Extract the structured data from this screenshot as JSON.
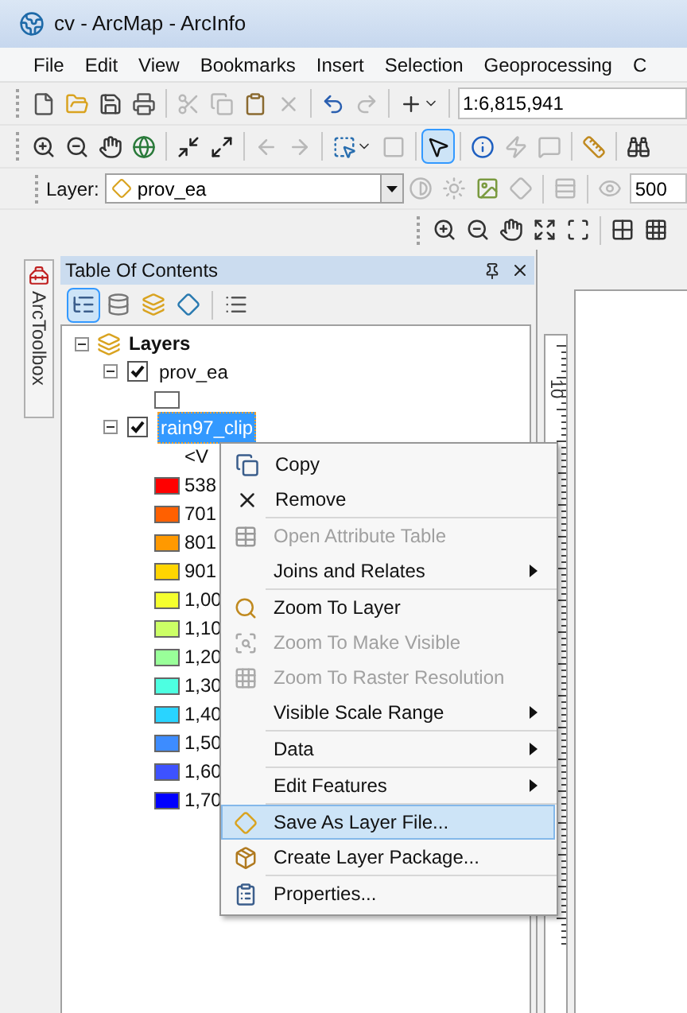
{
  "window": {
    "title": "cv - ArcMap - ArcInfo"
  },
  "menu_bar": [
    "File",
    "Edit",
    "View",
    "Bookmarks",
    "Insert",
    "Selection",
    "Geoprocessing",
    "C"
  ],
  "standard_toolbar": {
    "buttons": [
      {
        "disabled": false
      },
      {
        "disabled": false
      },
      {
        "disabled": false
      },
      {
        "disabled": false
      },
      {
        "disabled": true
      },
      {
        "disabled": true
      },
      {
        "disabled": false
      },
      {
        "disabled": true
      },
      {
        "disabled": false
      },
      {
        "disabled": true
      },
      {
        "disabled": false
      }
    ],
    "scale": "1:6,815,941"
  },
  "tools_toolbar": {
    "buttons": [
      {
        "disabled": false,
        "selected": false
      },
      {
        "disabled": false,
        "selected": false
      },
      {
        "disabled": false,
        "selected": false
      },
      {
        "disabled": false,
        "selected": false
      },
      {
        "disabled": false,
        "selected": false
      },
      {
        "disabled": false,
        "selected": false
      },
      {
        "disabled": true,
        "selected": false
      },
      {
        "disabled": true,
        "selected": false
      },
      {
        "disabled": false,
        "selected": false
      },
      {
        "disabled": true,
        "selected": false
      },
      {
        "disabled": false,
        "selected": true
      },
      {
        "disabled": false,
        "selected": false
      },
      {
        "disabled": true,
        "selected": false
      },
      {
        "disabled": true,
        "selected": false
      },
      {
        "disabled": false,
        "selected": false
      },
      {
        "disabled": false,
        "selected": false
      }
    ]
  },
  "effects_toolbar": {
    "label": "Layer:",
    "layer": "prov_ea",
    "buttons": [
      {
        "disabled": true
      },
      {
        "disabled": true
      },
      {
        "disabled": false
      },
      {
        "disabled": true
      },
      {
        "disabled": true
      },
      {
        "disabled": true
      }
    ],
    "value": "500"
  },
  "layout_toolbar": {
    "buttons": [
      {
        "disabled": false
      },
      {
        "disabled": false
      },
      {
        "disabled": false
      },
      {
        "disabled": false
      },
      {
        "disabled": false
      },
      {
        "disabled": false
      },
      {
        "disabled": false
      }
    ]
  },
  "side_tab": "ArcToolbox",
  "toc": {
    "title": "Table Of Contents",
    "views": [
      {
        "selected": true
      },
      {
        "selected": false
      },
      {
        "selected": false
      },
      {
        "selected": false
      },
      {
        "selected": false
      }
    ],
    "tree": {
      "label": "Layers",
      "expanded": true,
      "children": [
        {
          "label": "prov_ea",
          "checked": true,
          "expanded": true,
          "selected": false,
          "symbols": [
            {
              "color": "#ffffff"
            }
          ]
        },
        {
          "label": "rain97_clip",
          "checked": true,
          "expanded": true,
          "selected": true,
          "heading": "<V",
          "symbols": [
            {
              "label": "538",
              "color": "#ff0000"
            },
            {
              "label": "701",
              "color": "#ff6000"
            },
            {
              "label": "801",
              "color": "#ff9900"
            },
            {
              "label": "901",
              "color": "#ffd500"
            },
            {
              "label": "1,00",
              "color": "#f5ff2e"
            },
            {
              "label": "1,10",
              "color": "#ccff66"
            },
            {
              "label": "1,20",
              "color": "#99ff99"
            },
            {
              "label": "1,30",
              "color": "#4dffe1"
            },
            {
              "label": "1,40",
              "color": "#29d4ff"
            },
            {
              "label": "1,50",
              "color": "#3d8cff"
            },
            {
              "label": "1,60",
              "color": "#3d52ff"
            },
            {
              "label": "1,70",
              "color": "#0000ff"
            }
          ]
        }
      ]
    }
  },
  "context_menu": {
    "groups": [
      [
        {
          "label": "Copy",
          "disabled": false,
          "submenu": false,
          "selected": false
        },
        {
          "label": "Remove",
          "disabled": false,
          "submenu": false,
          "selected": false
        }
      ],
      [
        {
          "label": "Open Attribute Table",
          "disabled": true,
          "submenu": false,
          "selected": false
        },
        {
          "label": "Joins and Relates",
          "disabled": false,
          "submenu": true,
          "selected": false
        }
      ],
      [
        {
          "label": "Zoom To Layer",
          "disabled": false,
          "submenu": false,
          "selected": false
        },
        {
          "label": "Zoom To Make Visible",
          "disabled": true,
          "submenu": false,
          "selected": false
        },
        {
          "label": "Zoom To Raster Resolution",
          "disabled": true,
          "submenu": false,
          "selected": false
        },
        {
          "label": "Visible Scale Range",
          "disabled": false,
          "submenu": true,
          "selected": false
        }
      ],
      [
        {
          "label": "Data",
          "disabled": false,
          "submenu": true,
          "selected": false
        }
      ],
      [
        {
          "label": "Edit Features",
          "disabled": false,
          "submenu": true,
          "selected": false
        }
      ],
      [
        {
          "label": "Save As Layer File...",
          "disabled": false,
          "submenu": false,
          "selected": true
        },
        {
          "label": "Create Layer Package...",
          "disabled": false,
          "submenu": false,
          "selected": false
        }
      ],
      [
        {
          "label": "Properties...",
          "disabled": false,
          "submenu": false,
          "selected": false
        }
      ]
    ]
  },
  "map": {
    "ruler_label": "10"
  }
}
